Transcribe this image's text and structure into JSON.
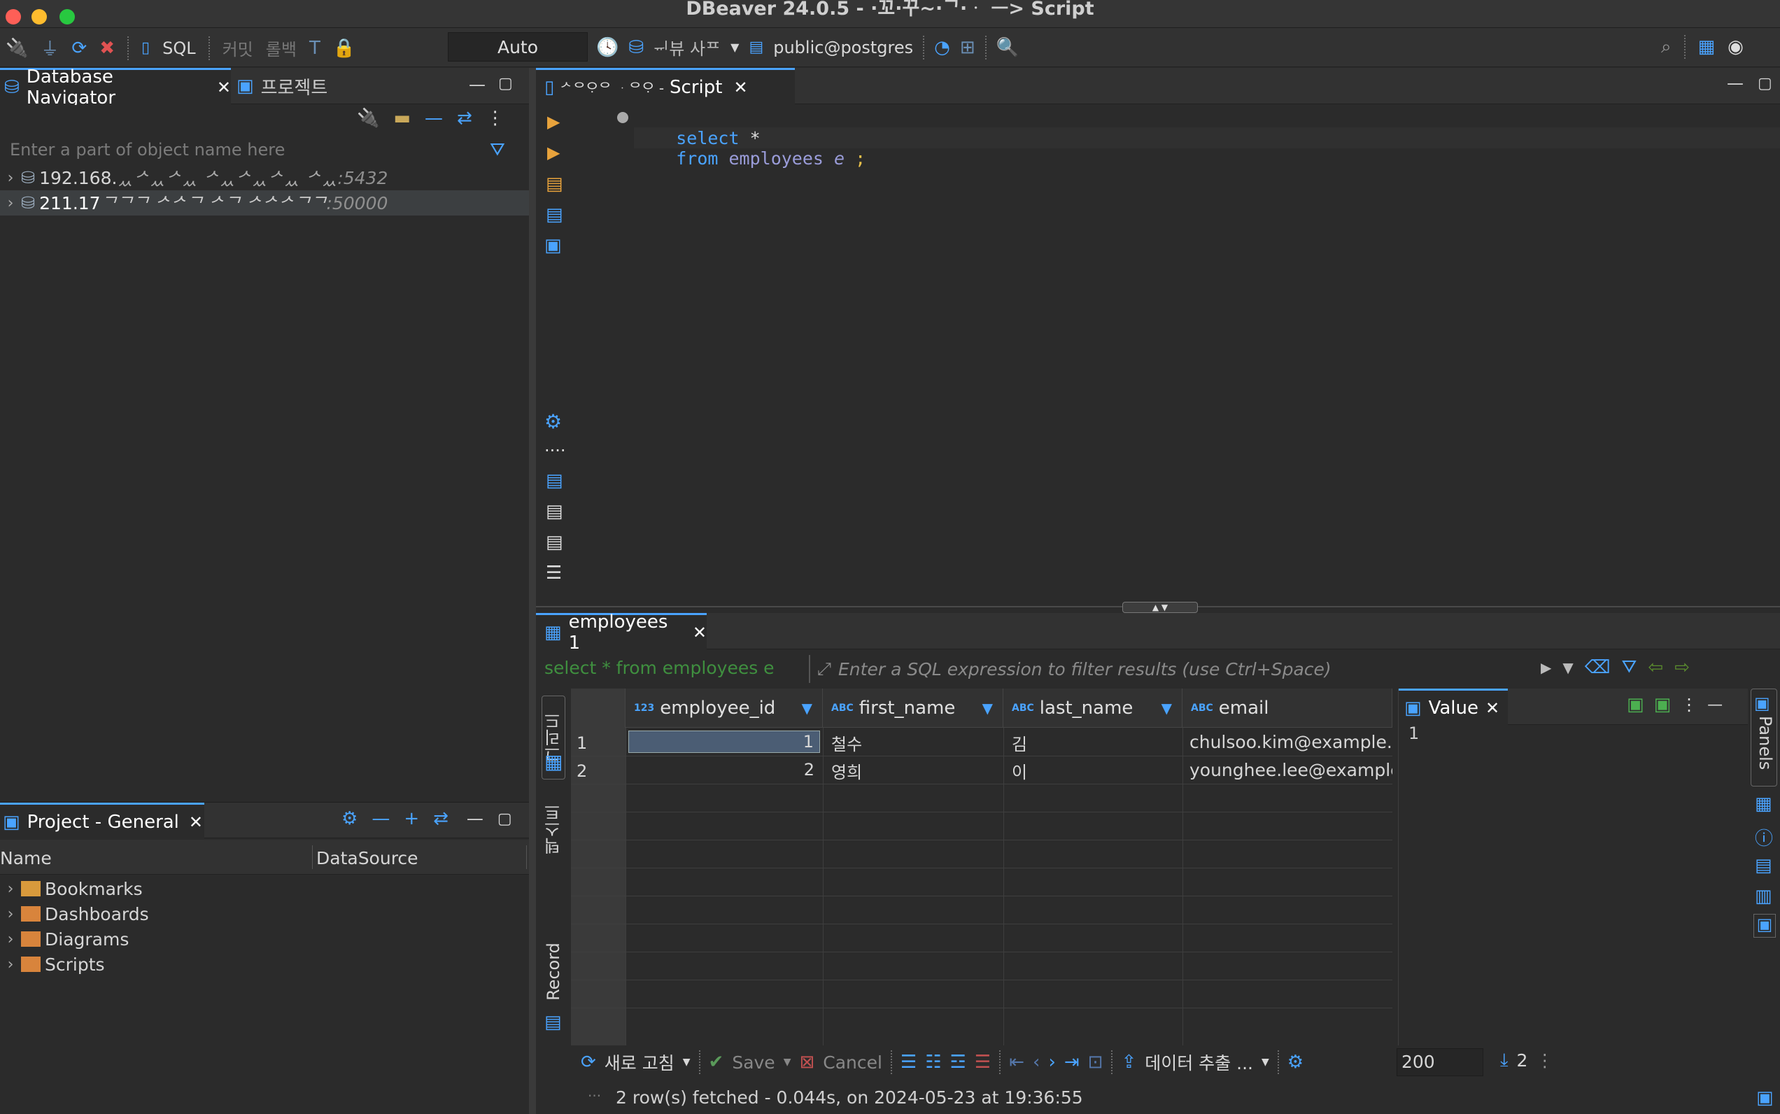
{
  "window": {
    "title": "DBeaver 24.0.5 - ·꼬·꾸~·ᄀ·ᆞ ᅳ> Script"
  },
  "toolbar": {
    "sql_label": "SQL",
    "commit_label": "커밋",
    "rollback_label": "롤백",
    "tx_mode": "Auto",
    "datasource_label": "ᆔ뷰 사ᄑ",
    "schema_label": "public@postgres"
  },
  "navigator": {
    "tab_db": "Database Navigator",
    "tab_project": "프로젝트",
    "filter_placeholder": "Enter a part of object name here",
    "connections": [
      {
        "label": "192.168.",
        "masked": "ᆻᄼᆻᄼᆻ ᄼᆻᄼᆻᄼᆻ ᄼᆻ",
        "port": ":5432"
      },
      {
        "label": "211.17",
        "masked": "ᄀᄀᄀ ᄼᄼᄀ ᄼᄀ ᄼᄼᄼᄀᄀ",
        "port": ":50000"
      }
    ]
  },
  "project": {
    "title": "Project - General",
    "col_name": "Name",
    "col_datasource": "DataSource",
    "items": [
      "Bookmarks",
      "Dashboards",
      "Diagrams",
      "Scripts"
    ]
  },
  "editor": {
    "tab_prefix": "ᄼᄋᄋᆞᄋ ᆞᄋᄋᆞ -",
    "tab_label": "Script",
    "sql_line1_kw": "select",
    "sql_line1_rest": " *",
    "sql_line2_kw": "from",
    "sql_line2_table": " employees",
    "sql_line2_alias": " e",
    "sql_line2_end": " ;"
  },
  "results": {
    "tab_label": "employees 1",
    "query_text": "select * from employees e",
    "filter_placeholder": "Enter a SQL expression to filter results (use Ctrl+Space)",
    "side_grid": "그리드",
    "side_text": "텍스트",
    "side_record": "Record",
    "columns": [
      {
        "type": "123",
        "name": "employee_id"
      },
      {
        "type": "ABC",
        "name": "first_name"
      },
      {
        "type": "ABC",
        "name": "last_name"
      },
      {
        "type": "ABC",
        "name": "email"
      }
    ],
    "rows": [
      {
        "num": "1",
        "employee_id": "1",
        "first_name": "철수",
        "last_name": "김",
        "email": "chulsoo.kim@example.c"
      },
      {
        "num": "2",
        "employee_id": "2",
        "first_name": "영희",
        "last_name": "이",
        "email": "younghee.lee@example"
      }
    ],
    "value_panel_title": "Value",
    "value_panel_content": "1",
    "panels_label": "Panels",
    "bottom": {
      "refresh": "새로 고침",
      "save": "Save",
      "cancel": "Cancel",
      "export": "데이터 추출 ...",
      "fetch_size": "200",
      "row_count": "2"
    },
    "status": "2 row(s) fetched - 0.044s, on 2024-05-23 at 19:36:55"
  }
}
